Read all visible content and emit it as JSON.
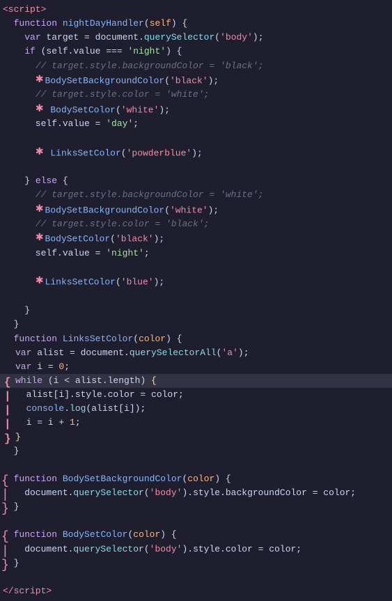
{
  "code": {
    "lines": [
      {
        "num": "",
        "content": "&lt;script&gt;",
        "type": "tag-line"
      },
      {
        "num": "",
        "content": "  function nightDayHandler(self) {",
        "type": "code"
      },
      {
        "num": "",
        "content": "    var target = document.querySelector(<span class='str-red'>'body'</span>);",
        "type": "code"
      },
      {
        "num": "",
        "content": "    if (self.value === <span class='str-green'>'night'</span>) {",
        "type": "code"
      },
      {
        "num": "",
        "content": "      <span class='comment'>// target.style.backgroundColor = 'black';</span>",
        "type": "code"
      },
      {
        "num": "",
        "content": "      <span class='marker'>&#x2731;</span>BodySetBackgroundColor(<span class='str-red'>'black'</span>);",
        "type": "code"
      },
      {
        "num": "",
        "content": "      <span class='comment'>// target.style.color = 'white';</span>",
        "type": "code"
      },
      {
        "num": "",
        "content": "      <span class='marker'>&#x2731;</span> BodySetColor(<span class='str-red'>'white'</span>);",
        "type": "code"
      },
      {
        "num": "",
        "content": "      self.value = <span class='str-green'>'day'</span>;",
        "type": "code"
      },
      {
        "num": "",
        "content": "",
        "type": "empty"
      },
      {
        "num": "",
        "content": "      <span class='marker'>&#x2731;</span> LinksSetColor(<span class='str-red'>'powderblue'</span>);",
        "type": "code"
      },
      {
        "num": "",
        "content": "",
        "type": "empty"
      },
      {
        "num": "",
        "content": "    } else {",
        "type": "code"
      },
      {
        "num": "",
        "content": "      <span class='comment'>// target.style.backgroundColor = 'white';</span>",
        "type": "code"
      },
      {
        "num": "",
        "content": "      <span class='marker'>&#x2731;</span>BodySetBackgroundColor(<span class='str-red'>'white'</span>);",
        "type": "code"
      },
      {
        "num": "",
        "content": "      <span class='comment'>// target.style.color = 'black';</span>",
        "type": "code"
      },
      {
        "num": "",
        "content": "      <span class='marker'>&#x2731;</span>BodySetColor(<span class='str-red'>'black'</span>);",
        "type": "code"
      },
      {
        "num": "",
        "content": "      self.value = <span class='str-green'>'night'</span>;",
        "type": "code"
      },
      {
        "num": "",
        "content": "",
        "type": "empty"
      },
      {
        "num": "",
        "content": "      <span class='marker'>&#x2731;</span>LinksSetColor(<span class='str-red'>'blue'</span>);",
        "type": "code"
      },
      {
        "num": "",
        "content": "",
        "type": "empty"
      },
      {
        "num": "",
        "content": "    }",
        "type": "code"
      },
      {
        "num": "",
        "content": "  }",
        "type": "code"
      },
      {
        "num": "",
        "content": "  function LinksSetColor(color) {",
        "type": "code"
      },
      {
        "num": "",
        "content": "    var alist = document.querySelectorAll(<span class='str-red'>'a'</span>);",
        "type": "code"
      },
      {
        "num": "",
        "content": "    var i = 0;",
        "type": "code"
      },
      {
        "num": "",
        "content": "    while (i &lt; alist.length) <span class='bracket'>{</span>",
        "type": "code-hl"
      },
      {
        "num": "",
        "content": "      alist[i].style.color = color;",
        "type": "code"
      },
      {
        "num": "",
        "content": "      console.log(alist[i]);",
        "type": "code"
      },
      {
        "num": "",
        "content": "      i = i + 1;",
        "type": "code"
      },
      {
        "num": "",
        "content": "    <span class='bracket'>}</span>",
        "type": "code"
      },
      {
        "num": "",
        "content": "  }",
        "type": "code"
      },
      {
        "num": "",
        "content": "",
        "type": "empty"
      },
      {
        "num": "",
        "content": "  function BodySetBackgroundColor(color) {",
        "type": "code"
      },
      {
        "num": "",
        "content": "    document.querySelector(<span class='str-red'>'body'</span>).style.backgroundColor = color;",
        "type": "code"
      },
      {
        "num": "",
        "content": "  }",
        "type": "code"
      },
      {
        "num": "",
        "content": "",
        "type": "empty"
      },
      {
        "num": "",
        "content": "  function BodySetColor(color) {",
        "type": "code"
      },
      {
        "num": "",
        "content": "    document.querySelector(<span class='str-red'>'body'</span>).style.color = color;",
        "type": "code"
      },
      {
        "num": "",
        "content": "  }",
        "type": "code"
      },
      {
        "num": "",
        "content": "",
        "type": "empty"
      },
      {
        "num": "",
        "content": "&lt;/script&gt;",
        "type": "tag-line"
      }
    ]
  }
}
